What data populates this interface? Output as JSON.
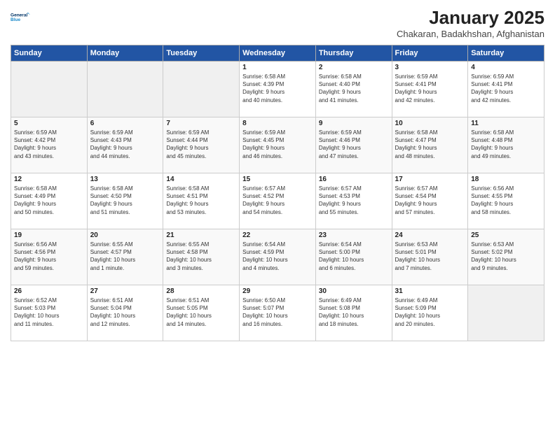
{
  "logo": {
    "line1": "General",
    "line2": "Blue"
  },
  "title": "January 2025",
  "subtitle": "Chakaran, Badakhshan, Afghanistan",
  "days_header": [
    "Sunday",
    "Monday",
    "Tuesday",
    "Wednesday",
    "Thursday",
    "Friday",
    "Saturday"
  ],
  "weeks": [
    [
      {
        "num": "",
        "info": ""
      },
      {
        "num": "",
        "info": ""
      },
      {
        "num": "",
        "info": ""
      },
      {
        "num": "1",
        "info": "Sunrise: 6:58 AM\nSunset: 4:39 PM\nDaylight: 9 hours\nand 40 minutes."
      },
      {
        "num": "2",
        "info": "Sunrise: 6:58 AM\nSunset: 4:40 PM\nDaylight: 9 hours\nand 41 minutes."
      },
      {
        "num": "3",
        "info": "Sunrise: 6:59 AM\nSunset: 4:41 PM\nDaylight: 9 hours\nand 42 minutes."
      },
      {
        "num": "4",
        "info": "Sunrise: 6:59 AM\nSunset: 4:41 PM\nDaylight: 9 hours\nand 42 minutes."
      }
    ],
    [
      {
        "num": "5",
        "info": "Sunrise: 6:59 AM\nSunset: 4:42 PM\nDaylight: 9 hours\nand 43 minutes."
      },
      {
        "num": "6",
        "info": "Sunrise: 6:59 AM\nSunset: 4:43 PM\nDaylight: 9 hours\nand 44 minutes."
      },
      {
        "num": "7",
        "info": "Sunrise: 6:59 AM\nSunset: 4:44 PM\nDaylight: 9 hours\nand 45 minutes."
      },
      {
        "num": "8",
        "info": "Sunrise: 6:59 AM\nSunset: 4:45 PM\nDaylight: 9 hours\nand 46 minutes."
      },
      {
        "num": "9",
        "info": "Sunrise: 6:59 AM\nSunset: 4:46 PM\nDaylight: 9 hours\nand 47 minutes."
      },
      {
        "num": "10",
        "info": "Sunrise: 6:58 AM\nSunset: 4:47 PM\nDaylight: 9 hours\nand 48 minutes."
      },
      {
        "num": "11",
        "info": "Sunrise: 6:58 AM\nSunset: 4:48 PM\nDaylight: 9 hours\nand 49 minutes."
      }
    ],
    [
      {
        "num": "12",
        "info": "Sunrise: 6:58 AM\nSunset: 4:49 PM\nDaylight: 9 hours\nand 50 minutes."
      },
      {
        "num": "13",
        "info": "Sunrise: 6:58 AM\nSunset: 4:50 PM\nDaylight: 9 hours\nand 51 minutes."
      },
      {
        "num": "14",
        "info": "Sunrise: 6:58 AM\nSunset: 4:51 PM\nDaylight: 9 hours\nand 53 minutes."
      },
      {
        "num": "15",
        "info": "Sunrise: 6:57 AM\nSunset: 4:52 PM\nDaylight: 9 hours\nand 54 minutes."
      },
      {
        "num": "16",
        "info": "Sunrise: 6:57 AM\nSunset: 4:53 PM\nDaylight: 9 hours\nand 55 minutes."
      },
      {
        "num": "17",
        "info": "Sunrise: 6:57 AM\nSunset: 4:54 PM\nDaylight: 9 hours\nand 57 minutes."
      },
      {
        "num": "18",
        "info": "Sunrise: 6:56 AM\nSunset: 4:55 PM\nDaylight: 9 hours\nand 58 minutes."
      }
    ],
    [
      {
        "num": "19",
        "info": "Sunrise: 6:56 AM\nSunset: 4:56 PM\nDaylight: 9 hours\nand 59 minutes."
      },
      {
        "num": "20",
        "info": "Sunrise: 6:55 AM\nSunset: 4:57 PM\nDaylight: 10 hours\nand 1 minute."
      },
      {
        "num": "21",
        "info": "Sunrise: 6:55 AM\nSunset: 4:58 PM\nDaylight: 10 hours\nand 3 minutes."
      },
      {
        "num": "22",
        "info": "Sunrise: 6:54 AM\nSunset: 4:59 PM\nDaylight: 10 hours\nand 4 minutes."
      },
      {
        "num": "23",
        "info": "Sunrise: 6:54 AM\nSunset: 5:00 PM\nDaylight: 10 hours\nand 6 minutes."
      },
      {
        "num": "24",
        "info": "Sunrise: 6:53 AM\nSunset: 5:01 PM\nDaylight: 10 hours\nand 7 minutes."
      },
      {
        "num": "25",
        "info": "Sunrise: 6:53 AM\nSunset: 5:02 PM\nDaylight: 10 hours\nand 9 minutes."
      }
    ],
    [
      {
        "num": "26",
        "info": "Sunrise: 6:52 AM\nSunset: 5:03 PM\nDaylight: 10 hours\nand 11 minutes."
      },
      {
        "num": "27",
        "info": "Sunrise: 6:51 AM\nSunset: 5:04 PM\nDaylight: 10 hours\nand 12 minutes."
      },
      {
        "num": "28",
        "info": "Sunrise: 6:51 AM\nSunset: 5:05 PM\nDaylight: 10 hours\nand 14 minutes."
      },
      {
        "num": "29",
        "info": "Sunrise: 6:50 AM\nSunset: 5:07 PM\nDaylight: 10 hours\nand 16 minutes."
      },
      {
        "num": "30",
        "info": "Sunrise: 6:49 AM\nSunset: 5:08 PM\nDaylight: 10 hours\nand 18 minutes."
      },
      {
        "num": "31",
        "info": "Sunrise: 6:49 AM\nSunset: 5:09 PM\nDaylight: 10 hours\nand 20 minutes."
      },
      {
        "num": "",
        "info": ""
      }
    ]
  ]
}
